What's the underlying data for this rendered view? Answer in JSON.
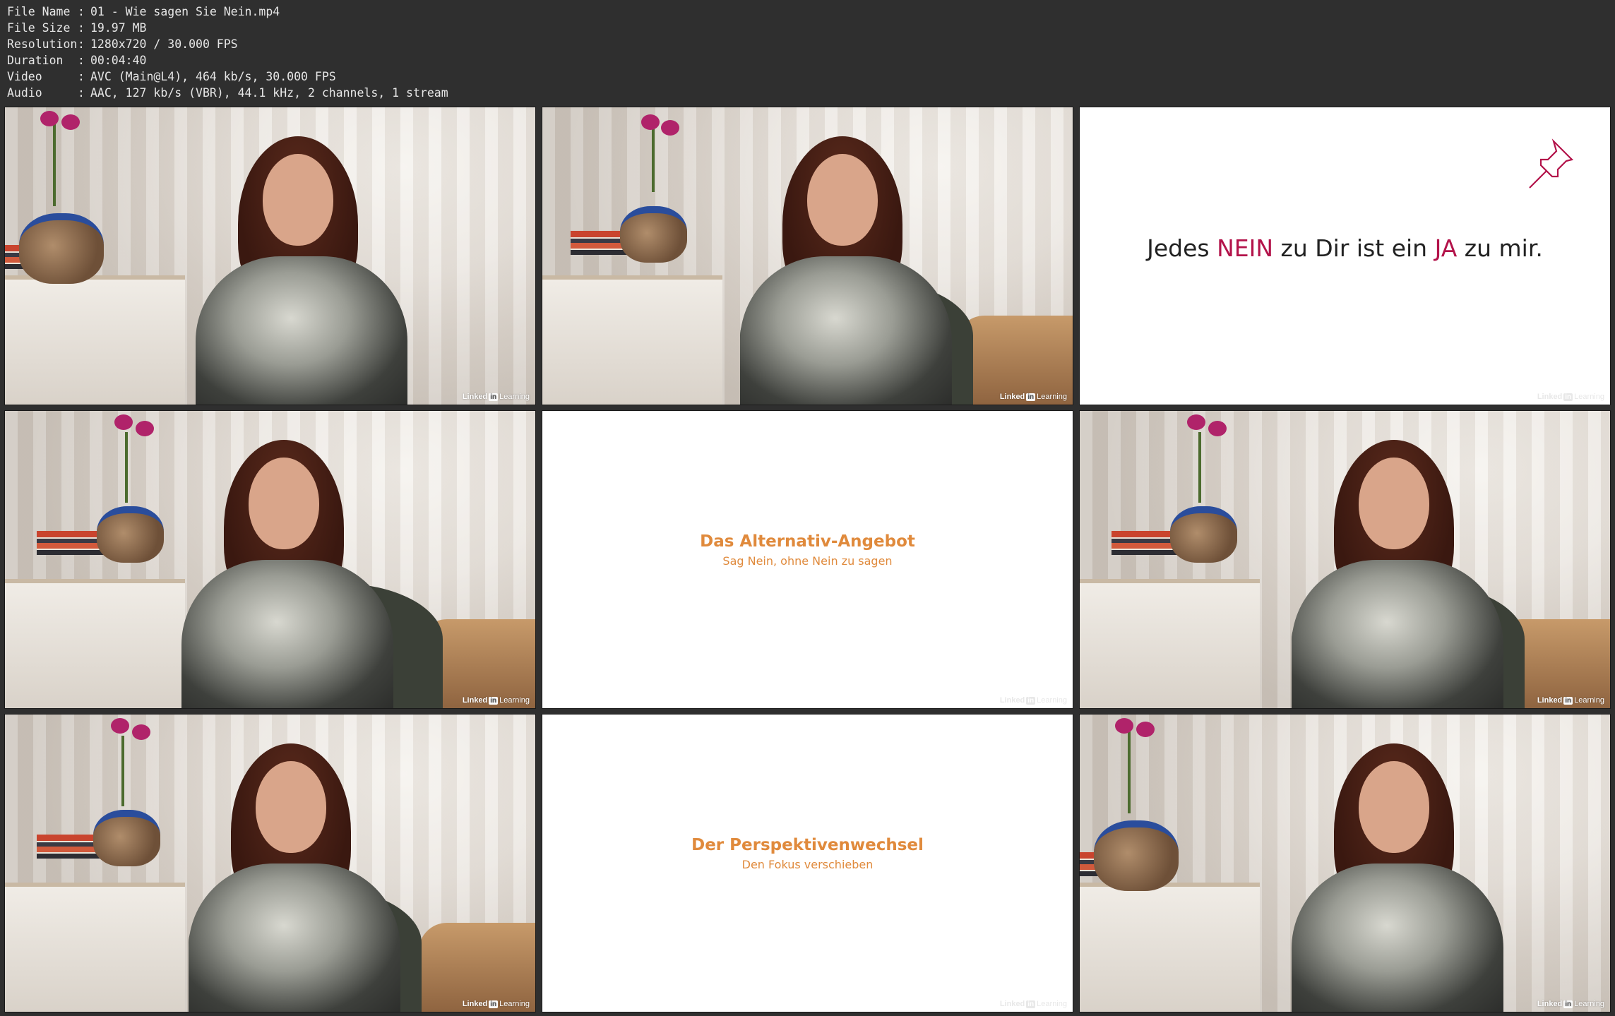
{
  "info": [
    {
      "key": "File Name",
      "value": "01 - Wie sagen Sie Nein.mp4"
    },
    {
      "key": "File Size",
      "value": "19.97 MB"
    },
    {
      "key": "Resolution",
      "value": "1280x720 / 30.000 FPS"
    },
    {
      "key": "Duration",
      "value": "00:04:40"
    },
    {
      "key": "Video",
      "value": "AVC (Main@L4), 464 kb/s, 30.000 FPS"
    },
    {
      "key": "Audio",
      "value": "AAC, 127 kb/s (VBR), 44.1 kHz, 2 channels, 1 stream"
    }
  ],
  "logo": {
    "brand": "Linked",
    "in": "in",
    "learning": "Learning"
  },
  "slides": {
    "quote": {
      "part1": "Jedes ",
      "nein": "NEIN",
      "part2": " zu Dir ist ein ",
      "ja": "JA",
      "part3": " zu mir."
    },
    "alt": {
      "title": "Das Alternativ-Angebot",
      "subtitle": "Sag Nein, ohne Nein zu sagen"
    },
    "persp": {
      "title": "Der Perspektivenwechsel",
      "subtitle": "Den Fokus verschieben"
    }
  },
  "colors": {
    "accent_orange": "#e08a3c",
    "accent_crimson": "#b3134a",
    "background": "#2f2f2f"
  },
  "icons": {
    "pin": "pushpin-icon"
  }
}
